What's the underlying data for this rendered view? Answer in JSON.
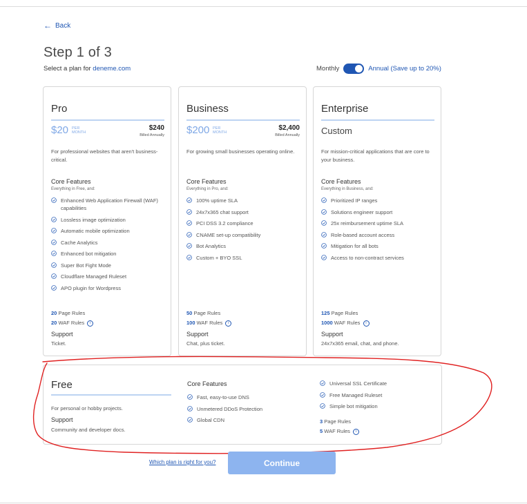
{
  "nav": {
    "back_label": "Back"
  },
  "header": {
    "step_title": "Step 1 of 3",
    "subtitle_prefix": "Select a plan for ",
    "domain": "deneme.com"
  },
  "billing_toggle": {
    "monthly_label": "Monthly",
    "annual_label": "Annual (Save up to 20%)",
    "selected": "Annual"
  },
  "plans": [
    {
      "name": "Pro",
      "price": "$20",
      "price_unit_line1": "PER",
      "price_unit_line2": "MONTH",
      "annual_price": "$240",
      "annual_note": "Billed Annually",
      "description": "For professional websites that aren't business-critical.",
      "core_features_title": "Core Features",
      "core_features_sub": "Everything in Free, and:",
      "features": [
        "Enhanced Web Application Firewall (WAF) capabilities",
        "Lossless image optimization",
        "Automatic mobile optimization",
        "Cache Analytics",
        "Enhanced bot mitigation",
        "Super Bot Fight Mode",
        "Cloudflare Managed Ruleset",
        "APO plugin for Wordpress"
      ],
      "page_rules_count": "20",
      "page_rules_label": "Page Rules",
      "waf_rules_count": "20",
      "waf_rules_label": "WAF Rules",
      "support_title": "Support",
      "support_text": "Ticket."
    },
    {
      "name": "Business",
      "price": "$200",
      "price_unit_line1": "PER",
      "price_unit_line2": "MONTH",
      "annual_price": "$2,400",
      "annual_note": "Billed Annually",
      "description": "For growing small businesses operating online.",
      "core_features_title": "Core Features",
      "core_features_sub": "Everything in Pro, and:",
      "features": [
        "100% uptime SLA",
        "24x7x365 chat support",
        "PCI DSS 3.2 compliance",
        "CNAME set-up compatibility",
        "Bot Analytics",
        "Custom + BYO SSL"
      ],
      "page_rules_count": "50",
      "page_rules_label": "Page Rules",
      "waf_rules_count": "100",
      "waf_rules_label": "WAF Rules",
      "support_title": "Support",
      "support_text": "Chat, plus ticket."
    },
    {
      "name": "Enterprise",
      "price_custom": "Custom",
      "description": "For mission-critical applications that are core to your business.",
      "core_features_title": "Core Features",
      "core_features_sub": "Everything in Business, and:",
      "features": [
        "Prioritized IP ranges",
        "Solutions engineer support",
        "25x reimbursement uptime SLA",
        "Role-based account access",
        "Mitigation for all bots",
        "Access to non-contract services"
      ],
      "page_rules_count": "125",
      "page_rules_label": "Page Rules",
      "waf_rules_count": "1000",
      "waf_rules_label": "WAF Rules",
      "support_title": "Support",
      "support_text": "24x7x365 email, chat, and phone."
    }
  ],
  "free_plan": {
    "name": "Free",
    "description": "For personal or hobby projects.",
    "support_title": "Support",
    "support_text": "Community and developer docs.",
    "core_features_title": "Core Features",
    "features_col1": [
      "Fast, easy-to-use DNS",
      "Unmetered DDoS Protection",
      "Global CDN"
    ],
    "features_col2": [
      "Universal SSL Certificate",
      "Free Managed Ruleset",
      "Simple bot mitigation"
    ],
    "page_rules_count": "3",
    "page_rules_label": "Page Rules",
    "waf_rules_count": "5",
    "waf_rules_label": "WAF Rules"
  },
  "footer": {
    "help_link": "Which plan is right for you?",
    "continue_label": "Continue"
  },
  "colors": {
    "accent": "#1f56b3",
    "price": "#7fa8e6",
    "continue_button": "#8db4ef",
    "annotation": "#e02020"
  },
  "icons": {
    "check": "check-circle-icon",
    "info": "info-icon",
    "back": "arrow-left-icon"
  }
}
